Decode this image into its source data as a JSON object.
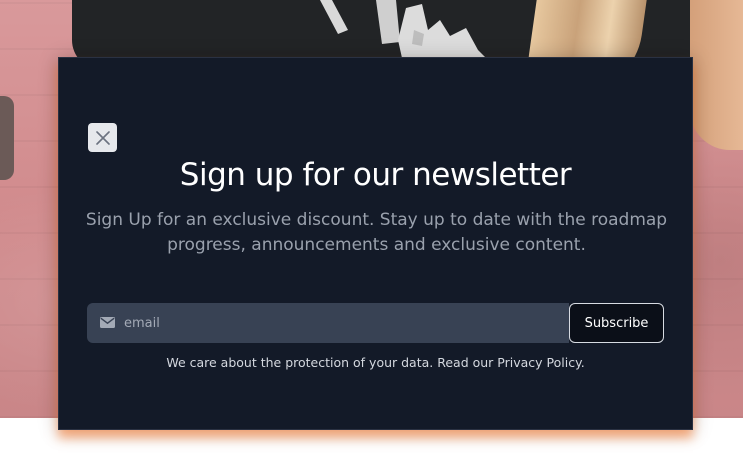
{
  "background": {
    "colors": {
      "wall": "#d08a8c",
      "shirt": "#222426"
    }
  },
  "modal": {
    "background": "#131a28",
    "title": "Sign up for our newsletter",
    "subtitle": "Sign Up for an exclusive discount. Stay up to date with the roadmap progress, announcements and exclusive content.",
    "close_icon": "close-icon",
    "form": {
      "email_placeholder": "email",
      "email_value": "",
      "mail_icon": "envelope-icon",
      "subscribe_label": "Subscribe"
    },
    "privacy": {
      "text": "We care about the protection of your data. Read our ",
      "link_label": "Privacy Policy",
      "suffix": "."
    }
  }
}
